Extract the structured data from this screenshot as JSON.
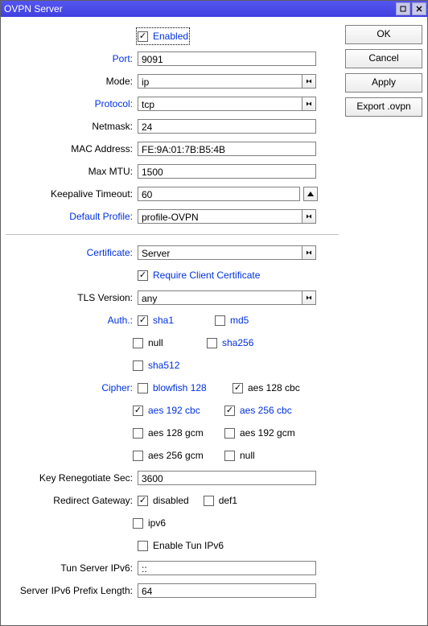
{
  "title": "OVPN Server",
  "side_buttons": {
    "ok": "OK",
    "cancel": "Cancel",
    "apply": "Apply",
    "export": "Export .ovpn"
  },
  "fields": {
    "enabled_label": "Enabled",
    "port_label": "Port:",
    "port": "9091",
    "mode_label": "Mode:",
    "mode": "ip",
    "protocol_label": "Protocol:",
    "protocol": "tcp",
    "netmask_label": "Netmask:",
    "netmask": "24",
    "mac_label": "MAC Address:",
    "mac": "FE:9A:01:7B:B5:4B",
    "mtu_label": "Max MTU:",
    "mtu": "1500",
    "keepalive_label": "Keepalive Timeout:",
    "keepalive": "60",
    "profile_label": "Default Profile:",
    "profile": "profile-OVPN",
    "cert_label": "Certificate:",
    "cert": "Server",
    "require_cc_label": "Require Client Certificate",
    "tls_label": "TLS Version:",
    "tls": "any",
    "auth_label": "Auth.:",
    "auth_sha1": "sha1",
    "auth_md5": "md5",
    "auth_null": "null",
    "auth_sha256": "sha256",
    "auth_sha512": "sha512",
    "cipher_label": "Cipher:",
    "c_bf128": "blowfish 128",
    "c_a128c": "aes 128 cbc",
    "c_a192c": "aes 192 cbc",
    "c_a256c": "aes 256 cbc",
    "c_a128g": "aes 128 gcm",
    "c_a192g": "aes 192 gcm",
    "c_a256g": "aes 256 gcm",
    "c_null": "null",
    "reneg_label": "Key Renegotiate Sec:",
    "reneg": "3600",
    "redir_label": "Redirect Gateway:",
    "r_disabled": "disabled",
    "r_def1": "def1",
    "r_ipv6": "ipv6",
    "tun6_enable": "Enable Tun IPv6",
    "tun6_label": "Tun Server IPv6:",
    "tun6": "::",
    "plen_label": "Server IPv6 Prefix Length:",
    "plen": "64"
  }
}
